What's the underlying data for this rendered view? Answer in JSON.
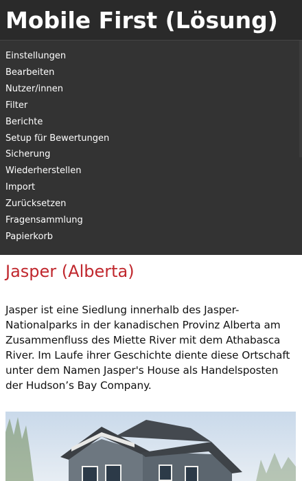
{
  "header": {
    "title": "Mobile First (Lösung)"
  },
  "nav": {
    "items": [
      "Einstellungen",
      "Bearbeiten",
      "Nutzer/innen",
      "Filter",
      "Berichte",
      "Setup für Bewertungen",
      "Sicherung",
      "Wiederherstellen",
      "Import",
      "Zurücksetzen",
      "Fragensammlung",
      "Papierkorb"
    ]
  },
  "article": {
    "heading": "Jasper (Alberta)",
    "body": "Jasper ist eine Siedlung innerhalb des Jasper-Nationalparks in der kanadischen Provinz Alberta am Zusammenfluss des Miette River mit dem Athabasca River. Im Laufe ihrer Geschichte diente diese Ortschaft unter dem Namen Jasper's House als Handelsposten der Hudson’s Bay Company."
  },
  "colors": {
    "header_bg": "#2a2a2a",
    "nav_bg": "#333333",
    "heading_red": "#c0272d"
  }
}
